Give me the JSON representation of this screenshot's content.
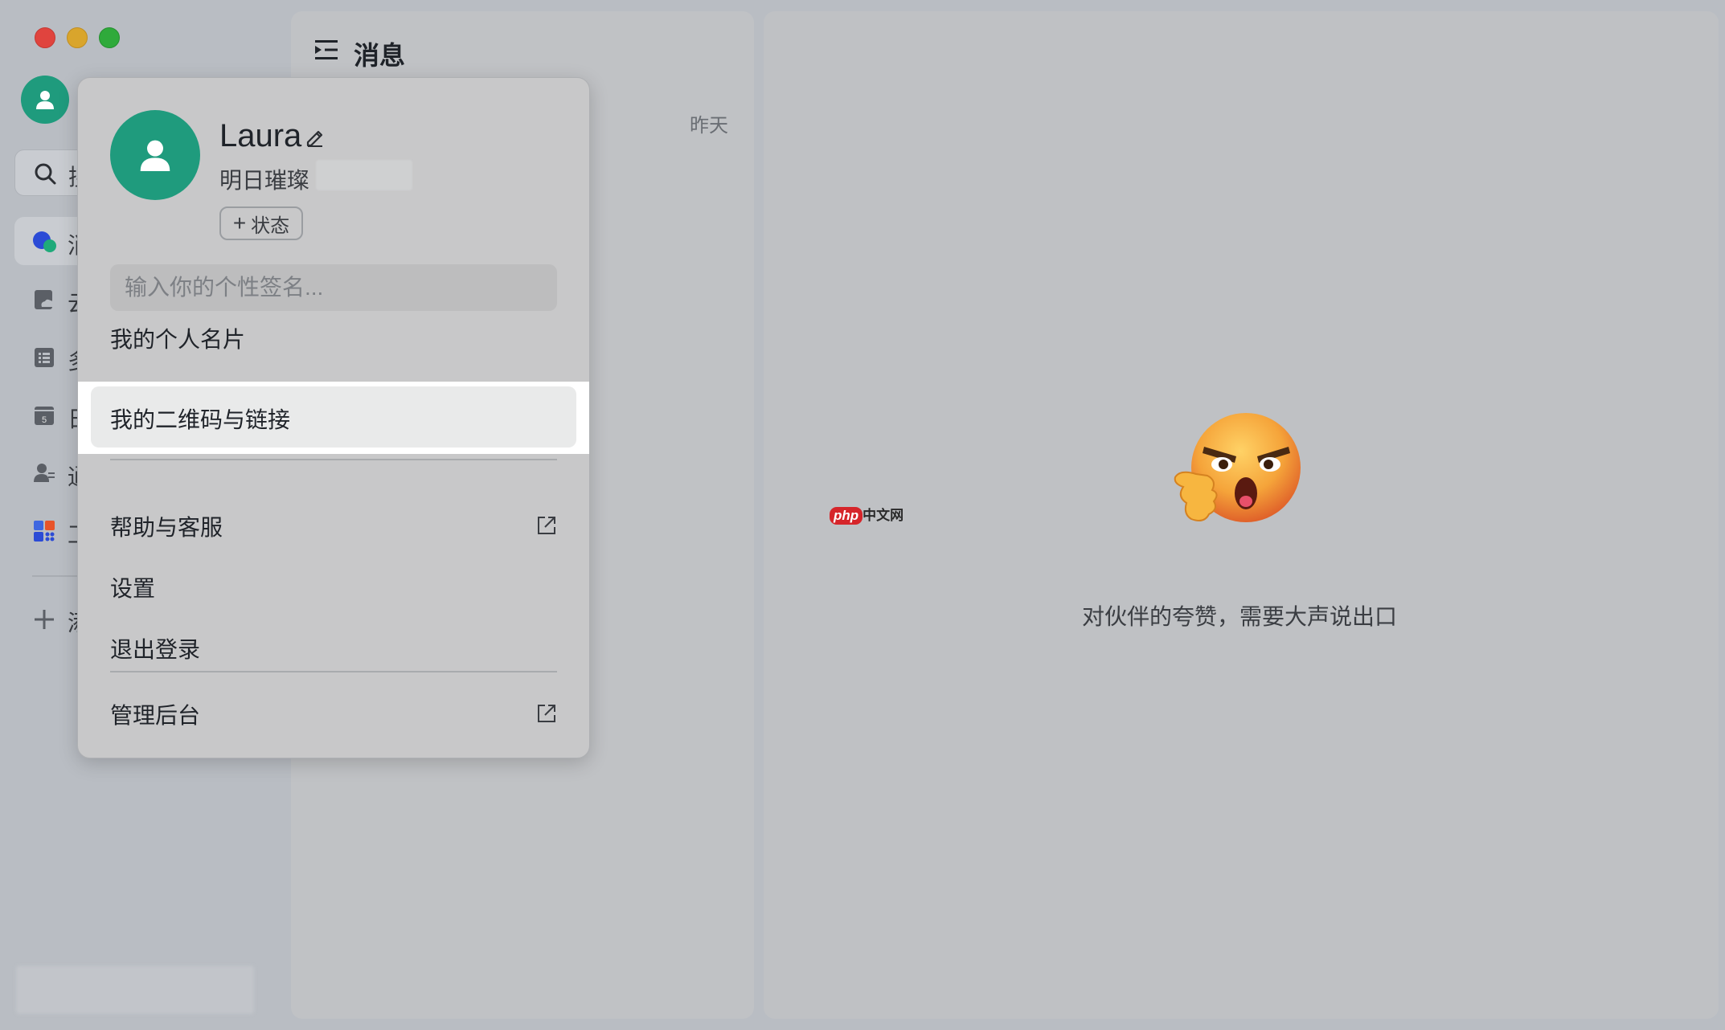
{
  "colors": {
    "avatar": "#1f9b7d",
    "highlight_bg": "#ffffff"
  },
  "list": {
    "title": "消息",
    "time": "昨天"
  },
  "nav": {
    "search_label": "搜",
    "items": [
      {
        "label": "消",
        "icon": "chat-bubbles-icon"
      },
      {
        "label": "云",
        "icon": "cloud-doc-icon"
      },
      {
        "label": "多",
        "icon": "list-icon"
      },
      {
        "label": "日",
        "icon": "calendar-icon"
      },
      {
        "label": "通",
        "icon": "contacts-icon"
      },
      {
        "label": "工",
        "icon": "apps-icon"
      },
      {
        "label": "添",
        "icon": "plus-icon"
      }
    ]
  },
  "profile": {
    "name": "Laura",
    "org": "明日璀璨",
    "status_label": "状态",
    "signature_placeholder": "输入你的个性签名...",
    "menu": {
      "card": "我的个人名片",
      "qr": "我的二维码与链接",
      "help": "帮助与客服",
      "settings": "设置",
      "logout": "退出登录",
      "admin": "管理后台"
    }
  },
  "chat": {
    "empty_text": "对伙伴的夸赞，需要大声说出口"
  },
  "watermark": {
    "php": "php",
    "zh": "中文网"
  }
}
